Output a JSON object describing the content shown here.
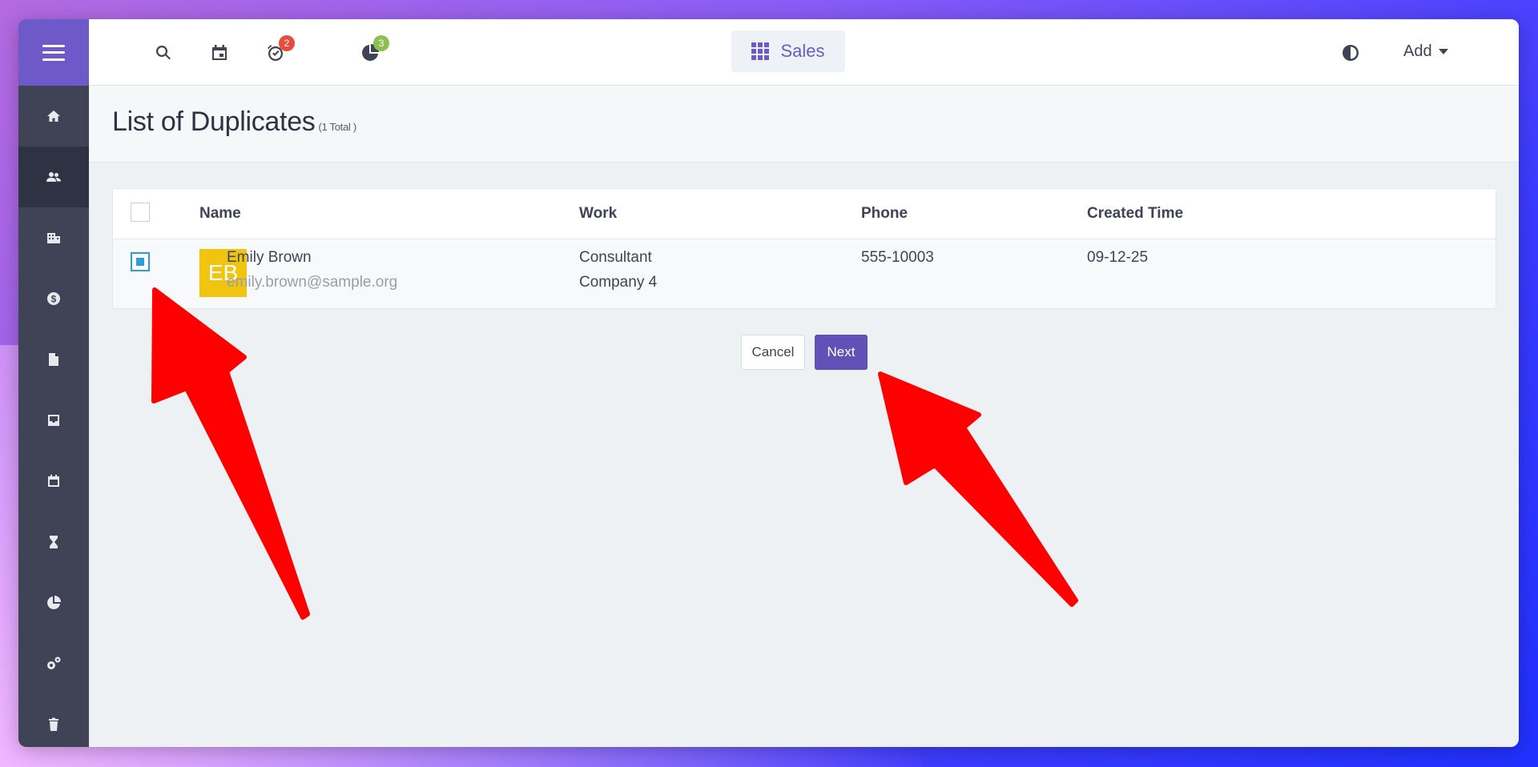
{
  "topbar": {
    "alarm_badge": "2",
    "chart_badge": "3",
    "app_label": "Sales",
    "add_label": "Add"
  },
  "page": {
    "title": "List of Duplicates",
    "total": "(1 Total )"
  },
  "table": {
    "headers": [
      "Name",
      "Work",
      "Phone",
      "Created Time"
    ],
    "rows": [
      {
        "initials": "EB",
        "name": "Emily Brown",
        "email": "emily.brown@sample.org",
        "work_title": "Consultant",
        "work_company": "Company 4",
        "phone": "555-10003",
        "created": "09-12-25",
        "checked": true
      }
    ]
  },
  "actions": {
    "cancel": "Cancel",
    "next": "Next"
  },
  "colors": {
    "brand": "#6d5ac8",
    "sidebar": "#3f4355",
    "avatar_initials_bg": "#f1c40f",
    "annotation_arrow": "#ff0000"
  },
  "sidebar_icons": [
    "home-icon",
    "contacts-icon",
    "building-icon",
    "dollar-icon",
    "document-icon",
    "inbox-icon",
    "calendar-icon",
    "hourglass-icon",
    "pie-chart-icon",
    "settings-icon",
    "trash-icon"
  ]
}
